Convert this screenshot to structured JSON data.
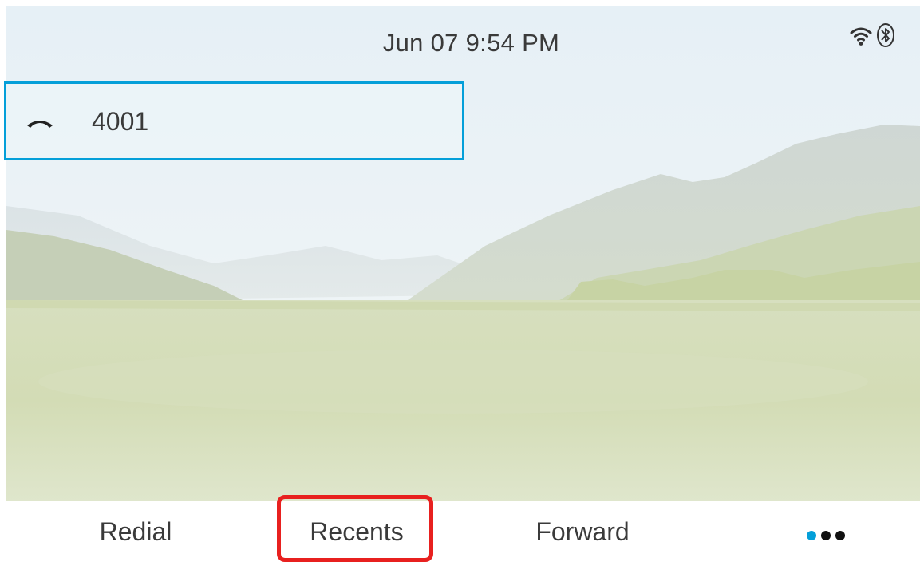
{
  "status_bar": {
    "datetime": "Jun 07 9:54 PM",
    "icons": [
      "wifi-icon",
      "bluetooth-icon"
    ]
  },
  "line_keys": [
    {
      "label": "4001",
      "icon": "handset-icon",
      "selected": true
    }
  ],
  "softkeys": [
    {
      "label": "Redial"
    },
    {
      "label": "Recents",
      "highlighted": true
    },
    {
      "label": "Forward"
    },
    {
      "icon": "more-dots-icon",
      "active_dot": 1
    }
  ],
  "colors": {
    "accent": "#049fd9",
    "highlight": "#e8201f",
    "text": "#3a3a3a"
  }
}
